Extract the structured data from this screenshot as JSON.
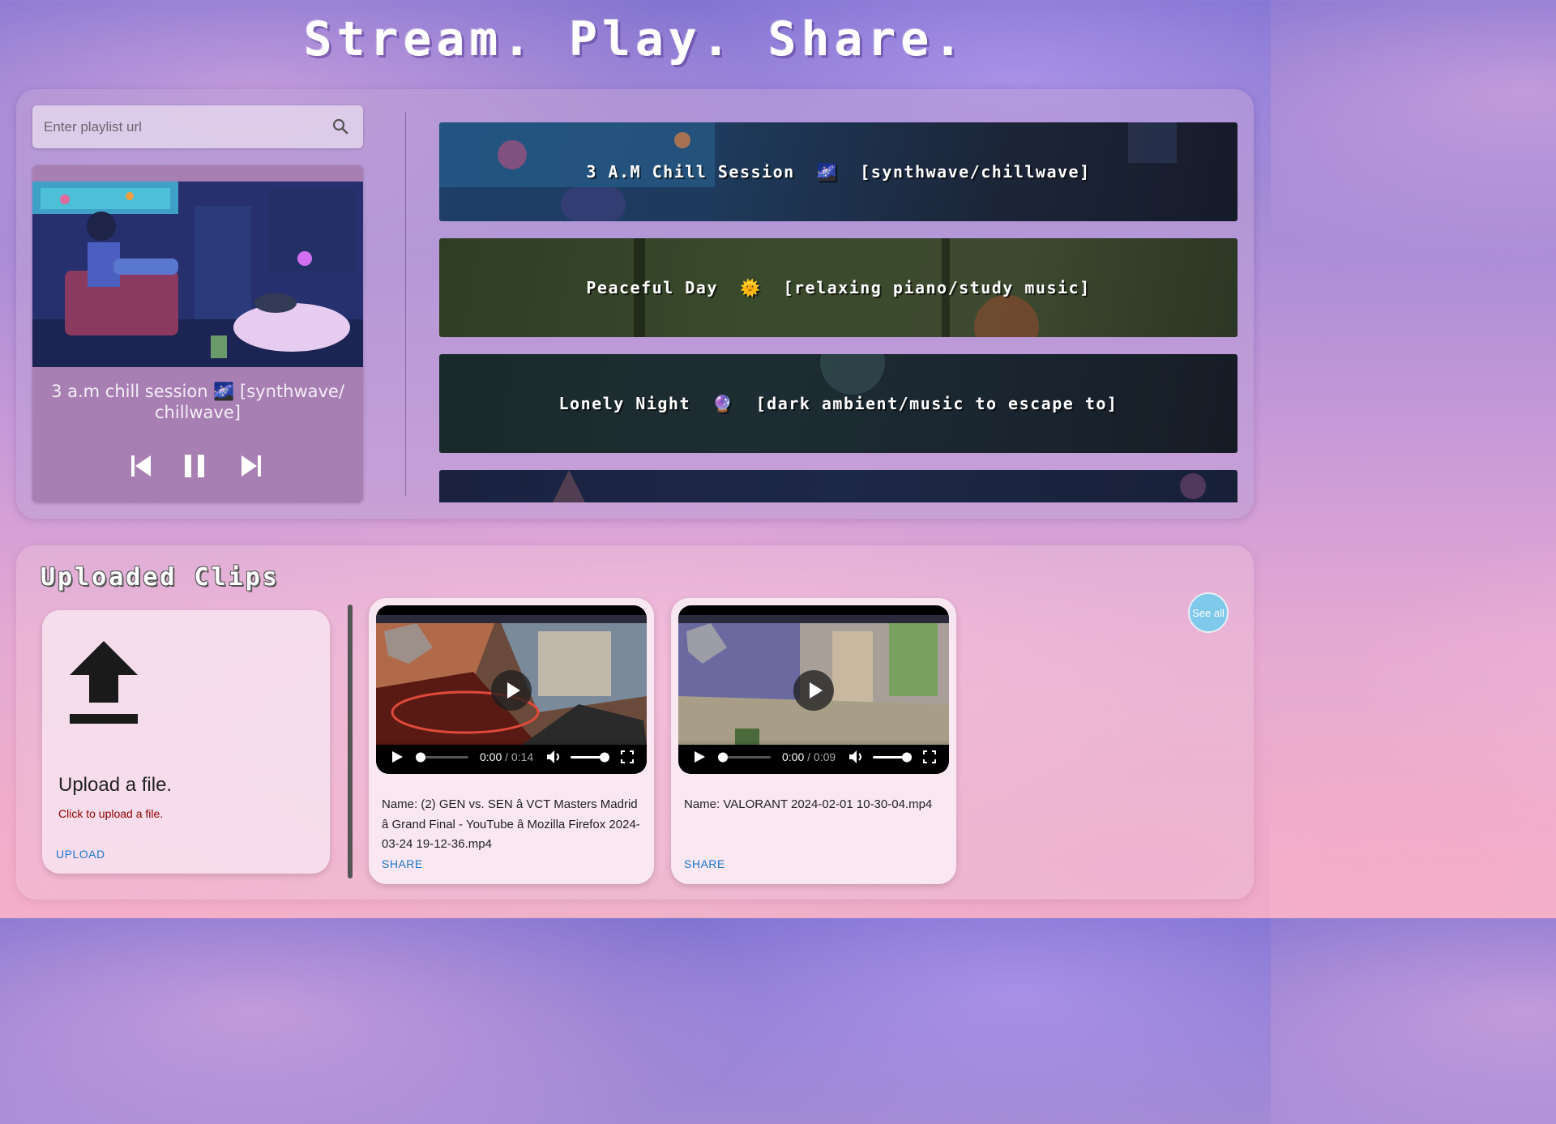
{
  "header": {
    "title": "Stream. Play. Share."
  },
  "player": {
    "search": {
      "placeholder": "Enter playlist url"
    },
    "now_playing": {
      "title": "3 a.m chill session 🌌 [synthwave/ chillwave]",
      "controls": [
        "previous",
        "pause",
        "next"
      ]
    },
    "playlist": [
      {
        "title": "3 A.M Chill Session",
        "emoji": "🌌",
        "tag": "[synthwave/chillwave]"
      },
      {
        "title": "Peaceful Day",
        "emoji": "🌞",
        "tag": "[relaxing piano/study music]"
      },
      {
        "title": "Lonely Night",
        "emoji": "🔮",
        "tag": "[dark ambient/music to escape to]"
      },
      {
        "title": "",
        "emoji": "",
        "tag": ""
      }
    ]
  },
  "clips": {
    "title": "Uploaded Clips",
    "see_all_label": "See all",
    "upload": {
      "heading": "Upload a file.",
      "subtext": "Click to upload a file.",
      "button_label": "UPLOAD"
    },
    "items": [
      {
        "name": "Name: (2) GEN vs. SEN â VCT Masters Madrid â Grand Final - YouTube â Mozilla Firefox 2024-03-24 19-12-36.mp4",
        "current_time": "0:00",
        "duration": " / 0:14",
        "share_label": "SHARE"
      },
      {
        "name": "Name: VALORANT 2024-02-01 10-30-04.mp4",
        "current_time": "0:00",
        "duration": " / 0:09",
        "share_label": "SHARE"
      }
    ]
  },
  "colors": {
    "accent_blue": "#1976d2",
    "error_red": "#8b0000",
    "see_all_bg": "#7fc9ea",
    "now_playing_bg": "#a87fb2"
  }
}
